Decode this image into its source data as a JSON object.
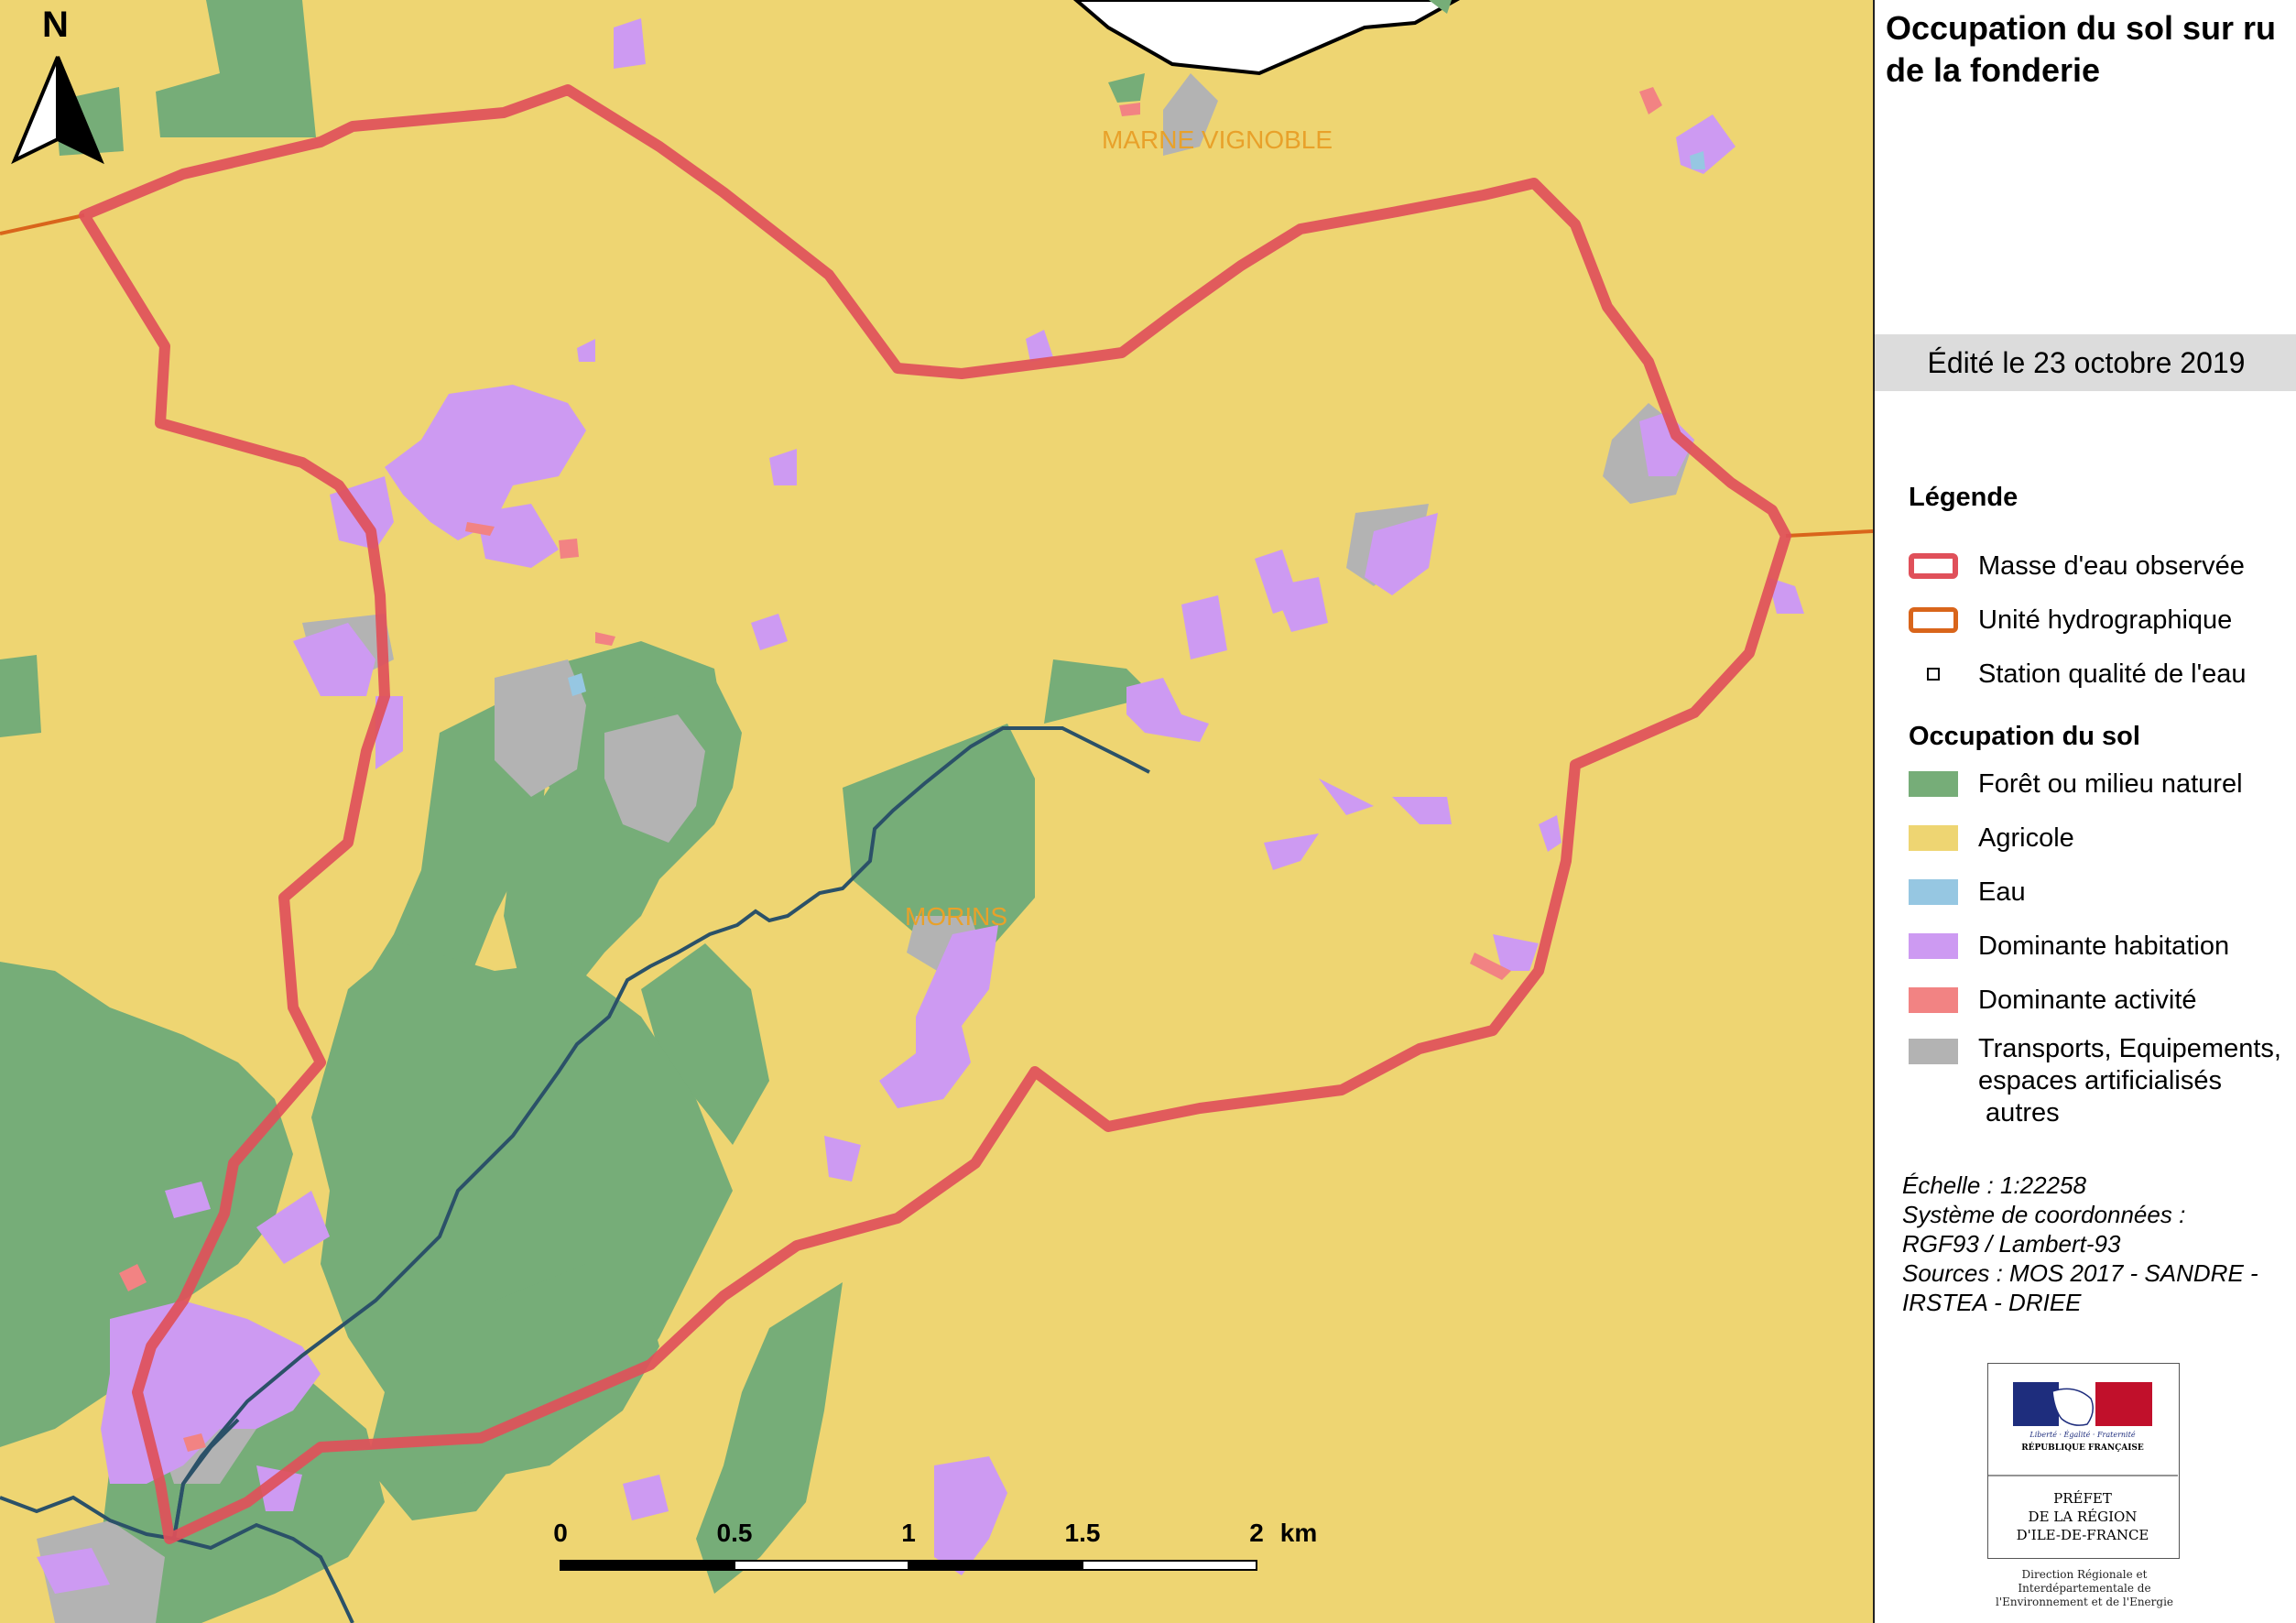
{
  "title": "Occupation du sol sur ru de la fonderie",
  "edit_date": "Édité le 23 octobre 2019",
  "north_label": "N",
  "place_labels": [
    "MARNE VIGNOBLE",
    "MORINS"
  ],
  "scale_bar": {
    "labels": [
      "0",
      "0.5",
      "1",
      "1.5",
      "2"
    ],
    "unit": "km"
  },
  "legend": {
    "heading": "Légende",
    "items": [
      {
        "label": "Masse d'eau observée",
        "color": "#e0505a",
        "kind": "outline"
      },
      {
        "label": "Unité hydrographique",
        "color": "#d9651b",
        "kind": "outline"
      },
      {
        "label": "Station qualité de l'eau",
        "color": "#000000",
        "kind": "point"
      }
    ],
    "landuse_heading": "Occupation du sol",
    "landuse": [
      {
        "label": "Forêt ou milieu naturel",
        "color": "#76ad78"
      },
      {
        "label": "Agricole",
        "color": "#eed572"
      },
      {
        "label": "Eau",
        "color": "#96c7e2"
      },
      {
        "label": "Dominante habitation",
        "color": "#cd9af2"
      },
      {
        "label": "Dominante activité",
        "color": "#f28383"
      },
      {
        "label": "Transports, Equipements, espaces artificialisés autres",
        "lines": [
          "Transports, Equipements,",
          "espaces artificialisés",
          " autres"
        ],
        "color": "#b3b3b3"
      }
    ]
  },
  "meta": {
    "scale": "Échelle :  1:22258",
    "crs_label": "Système de coordonnées :",
    "crs": "RGF93 / Lambert-93",
    "sources": "Sources : MOS 2017 - SANDRE - IRSTEA - DRIEE"
  },
  "logo": {
    "motto": "Liberté · Égalité · Fraternité",
    "republic": "RÉPUBLIQUE FRANÇAISE",
    "prefect": [
      "PRÉFET",
      "DE LA RÉGION",
      "D'ILE-DE-FRANCE"
    ],
    "caption": "Direction Régionale et Interdépartementale de l'Environnement et de l'Energie"
  },
  "colors": {
    "agricole": "#eed572",
    "foret": "#76ad78",
    "habitation": "#cd9af2",
    "activite": "#f28383",
    "transports": "#b3b3b3",
    "eau": "#96c7e2",
    "masse_eau": "#e0505a",
    "unite_hydro": "#d9651b",
    "river": "#2b5168"
  }
}
